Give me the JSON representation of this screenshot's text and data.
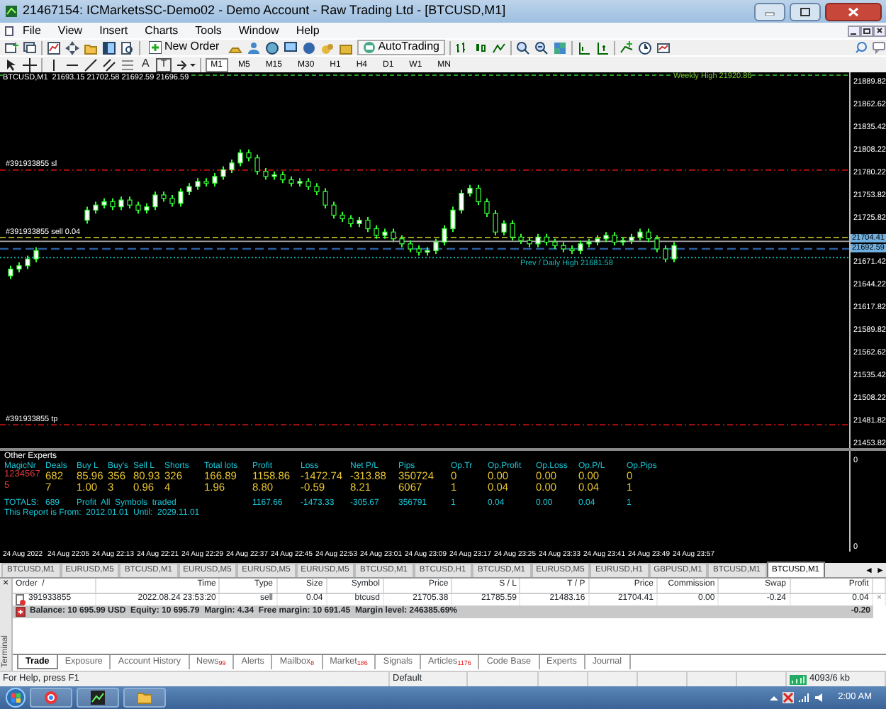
{
  "window": {
    "title": "21467154: ICMarketsSC-Demo02 - Demo Account - Raw Trading Ltd - [BTCUSD,M1]"
  },
  "menu": [
    "File",
    "View",
    "Insert",
    "Charts",
    "Tools",
    "Window",
    "Help"
  ],
  "toolbar": {
    "new_order": "New Order",
    "autotrading": "AutoTrading",
    "text_tool": "A",
    "label_tool": "T"
  },
  "timeframes": [
    {
      "label": "M1",
      "selected": true
    },
    {
      "label": "M5",
      "selected": false
    },
    {
      "label": "M15",
      "selected": false
    },
    {
      "label": "M30",
      "selected": false
    },
    {
      "label": "H1",
      "selected": false
    },
    {
      "label": "H4",
      "selected": false
    },
    {
      "label": "D1",
      "selected": false
    },
    {
      "label": "W1",
      "selected": false
    },
    {
      "label": "MN",
      "selected": false
    }
  ],
  "chart": {
    "symbol": "BTCUSD,M1",
    "ohlc": "21693.15 21702.58 21692.59 21696.59",
    "weekly_label": "Weekly High 21920.86",
    "lines": [
      {
        "label": "#391933855 sl",
        "kind": "sl"
      },
      {
        "label": "#391933855 sell 0.04",
        "kind": "entry"
      },
      {
        "label": "#391933855 tp",
        "kind": "tp"
      }
    ],
    "daily_label": "Prev / Daily High 21681.58",
    "price_axis": [
      "21889.82",
      "21862.62",
      "21835.42",
      "21808.22",
      "21780.22",
      "21753.82",
      "21725.82",
      "21671.42",
      "21644.22",
      "21617.82",
      "21589.82",
      "21562.62",
      "21535.42",
      "21508.22",
      "21481.82",
      "21453.82"
    ],
    "price_markers": [
      "21704.41",
      "21692.59"
    ],
    "subwindow_axis": [
      "0",
      "0"
    ],
    "time_axis": [
      "24 Aug 2022",
      "24 Aug 22:05",
      "24 Aug 22:13",
      "24 Aug 22:21",
      "24 Aug 22:29",
      "24 Aug 22:37",
      "24 Aug 22:45",
      "24 Aug 22:53",
      "24 Aug 23:01",
      "24 Aug 23:09",
      "24 Aug 23:17",
      "24 Aug 23:25",
      "24 Aug 23:33",
      "24 Aug 23:41",
      "24 Aug 23:49",
      "24 Aug 23:57"
    ]
  },
  "experts": {
    "title": "Other Experts",
    "columns": [
      "MagicNr",
      "Deals",
      "Buy L",
      "Buy's",
      "Sell L",
      "Shorts",
      "Total lots",
      "Profit",
      "Loss",
      "Net P/L",
      "Pips",
      "Op.Tr",
      "Op.Profit",
      "Op.Loss",
      "Op.P/L",
      "Op.Pips"
    ],
    "rows": [
      [
        "1234567",
        "682",
        "85.96",
        "356",
        "80.93",
        "326",
        "166.89",
        "1158.86",
        "-1472.74",
        "-313.88",
        "350724",
        "0",
        "0.00",
        "0.00",
        "0.00",
        "0"
      ],
      [
        "5",
        "7",
        "1.00",
        "3",
        "0.96",
        "4",
        "1.96",
        "8.80",
        "-0.59",
        "8.21",
        "6067",
        "1",
        "0.04",
        "0.00",
        "0.04",
        "1"
      ]
    ],
    "totals": {
      "label": "TOTALS:",
      "deals": "689",
      "note": "Profit  All  Symbols  traded",
      "values": [
        "1167.66",
        "-1473.33",
        "-305.67",
        "356791",
        "1",
        "0.04",
        "0.00",
        "0.04",
        "1"
      ]
    },
    "report": "This Report is From:  2012.01.01  Until:  2029.11.01"
  },
  "chart_tabs": [
    {
      "label": "BTCUSD,M1",
      "selected": false
    },
    {
      "label": "EURUSD,M5",
      "selected": false
    },
    {
      "label": "BTCUSD,M1",
      "selected": false
    },
    {
      "label": "EURUSD,M5",
      "selected": false
    },
    {
      "label": "EURUSD,M5",
      "selected": false
    },
    {
      "label": "EURUSD,M5",
      "selected": false
    },
    {
      "label": "BTCUSD,M1",
      "selected": false
    },
    {
      "label": "BTCUSD,H1",
      "selected": false
    },
    {
      "label": "BTCUSD,M1",
      "selected": false
    },
    {
      "label": "EURUSD,M5",
      "selected": false
    },
    {
      "label": "EURUSD,H1",
      "selected": false
    },
    {
      "label": "GBPUSD,M1",
      "selected": false
    },
    {
      "label": "BTCUSD,M1",
      "selected": false
    },
    {
      "label": "BTCUSD,M1",
      "selected": true
    }
  ],
  "tab_scroll": [
    "◄",
    "►"
  ],
  "terminal": {
    "side_label": "Terminal",
    "close": "×",
    "columns": [
      "Order  /",
      "Time",
      "Type",
      "Size",
      "Symbol",
      "Price",
      "S / L",
      "T / P",
      "Price",
      "Commission",
      "Swap",
      "Profit"
    ],
    "rows": [
      {
        "cells": [
          "391933855",
          "2022.08.24 23:53:20",
          "sell",
          "0.04",
          "btcusd",
          "21705.38",
          "21785.59",
          "21483.16",
          "21704.41",
          "0.00",
          "-0.24",
          "0.04"
        ],
        "close": "×"
      }
    ],
    "summary": "Balance: 10 695.99 USD  Equity: 10 695.79  Margin: 4.34  Free margin: 10 691.45  Margin level: 246385.69%",
    "total": "-0.20",
    "tabs": [
      {
        "label": "Trade",
        "selected": true
      },
      {
        "label": "Exposure",
        "selected": false
      },
      {
        "label": "Account History",
        "selected": false
      },
      {
        "label": "News",
        "count": "99",
        "selected": false
      },
      {
        "label": "Alerts",
        "selected": false
      },
      {
        "label": "Mailbox",
        "count": "8",
        "selected": false
      },
      {
        "label": "Market",
        "count": "186",
        "selected": false
      },
      {
        "label": "Signals",
        "selected": false
      },
      {
        "label": "Articles",
        "count": "1176",
        "selected": false
      },
      {
        "label": "Code Base",
        "selected": false
      },
      {
        "label": "Experts",
        "selected": false
      },
      {
        "label": "Journal",
        "selected": false
      }
    ]
  },
  "status_bar": {
    "help": "For Help, press F1",
    "profile": "Default",
    "memory": "4093/6 kb"
  },
  "taskbar": {
    "clock": "2:00 AM"
  }
}
